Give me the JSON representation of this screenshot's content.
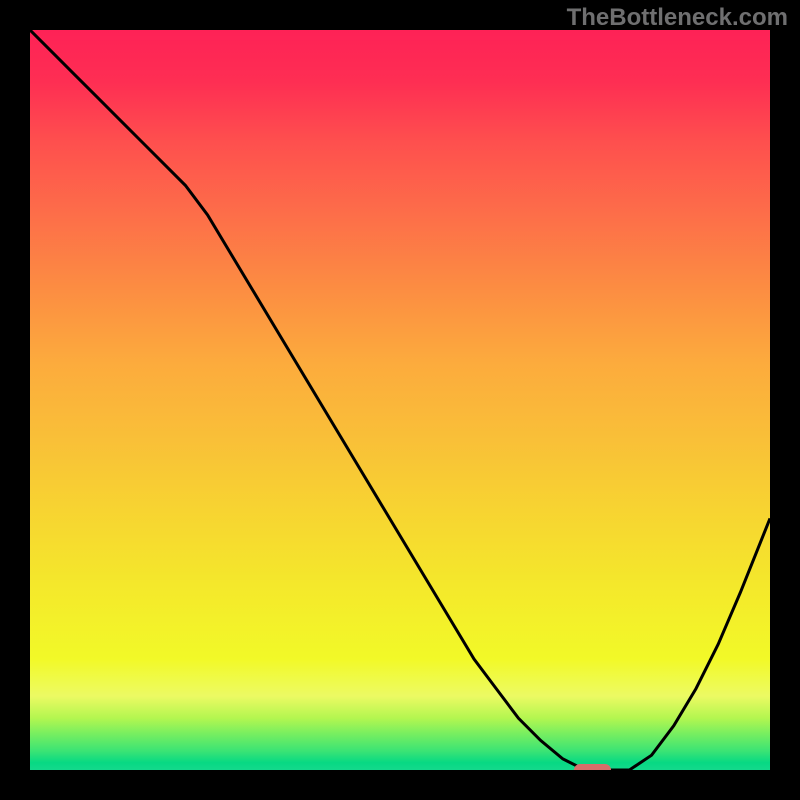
{
  "source_watermark": "TheBottleneck.com",
  "chart_data": {
    "type": "line",
    "title": "",
    "xlabel": "",
    "ylabel": "",
    "xlim": [
      0,
      100
    ],
    "ylim": [
      0,
      100
    ],
    "x": [
      0,
      3,
      6,
      9,
      12,
      15,
      18,
      21,
      24,
      27,
      30,
      33,
      36,
      39,
      42,
      45,
      48,
      51,
      54,
      57,
      60,
      63,
      66,
      69,
      72,
      75,
      78,
      81,
      84,
      87,
      90,
      93,
      96,
      100
    ],
    "values": [
      100,
      97,
      94,
      91,
      88,
      85,
      82,
      79,
      75,
      70,
      65,
      60,
      55,
      50,
      45,
      40,
      35,
      30,
      25,
      20,
      15,
      11,
      7,
      4,
      1.5,
      0,
      0,
      0,
      2,
      6,
      11,
      17,
      24,
      34
    ],
    "minimum_marker": {
      "x": 76,
      "y": 0,
      "width_pct": 5
    },
    "colors": {
      "curve": "#000000",
      "marker": "#d66e6a",
      "background_top": "#fe2256",
      "background_bottom": "#14d98c"
    }
  }
}
